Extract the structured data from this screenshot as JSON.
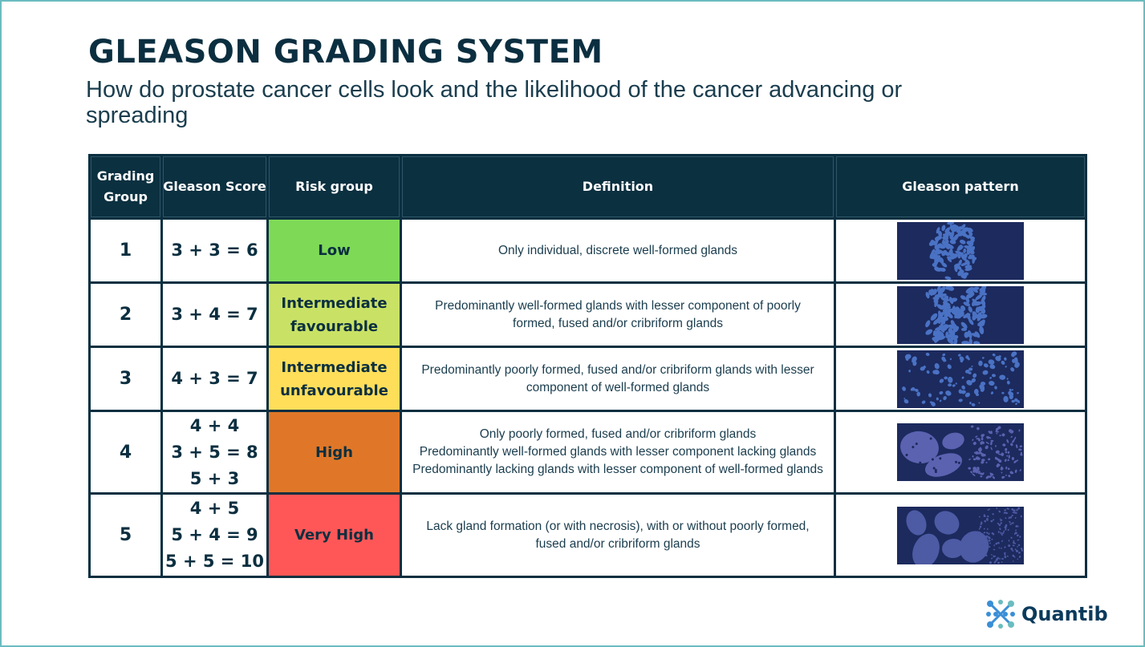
{
  "header": {
    "title": "GLEASON GRADING SYSTEM",
    "subtitle": "How do prostate cancer cells look and the likelihood of the cancer advancing or spreading"
  },
  "table": {
    "columns": [
      "Grading Group",
      "Gleason Score",
      "Risk group",
      "Definition",
      "Gleason pattern"
    ],
    "rows": [
      {
        "group": "1",
        "scores": [
          "3 + 3 = 6"
        ],
        "risk": "Low",
        "risk_color": "#7ed957",
        "definition": [
          "Only individual, discrete well-formed glands"
        ],
        "pattern_icon": "gleason-pattern-1-image"
      },
      {
        "group": "2",
        "scores": [
          "3 + 4 = 7"
        ],
        "risk": "Intermediate favourable",
        "risk_color": "#c9e265",
        "definition": [
          "Predominantly well-formed glands with lesser component of poorly formed, fused and/or cribriform glands"
        ],
        "pattern_icon": "gleason-pattern-2-image"
      },
      {
        "group": "3",
        "scores": [
          "4 + 3 = 7"
        ],
        "risk": "Intermediate unfavourable",
        "risk_color": "#ffde59",
        "definition": [
          "Predominantly poorly formed, fused and/or cribriform glands with lesser component of well-formed glands"
        ],
        "pattern_icon": "gleason-pattern-3-image"
      },
      {
        "group": "4",
        "scores": [
          "4 + 4",
          "3 + 5 = 8",
          "5 + 3"
        ],
        "risk": "High",
        "risk_color": "#e07728",
        "definition": [
          "Only poorly formed, fused and/or cribriform glands",
          "Predominantly well-formed glands with lesser component lacking glands",
          "Predominantly lacking glands with lesser component of well-formed glands"
        ],
        "pattern_icon": "gleason-pattern-4-image"
      },
      {
        "group": "5",
        "scores": [
          "4 + 5",
          "5 + 4 = 9",
          "5 + 5 = 10"
        ],
        "risk": "Very High",
        "risk_color": "#ff5757",
        "definition": [
          "Lack gland formation (or with necrosis), with or without poorly formed, fused and/or cribriform glands"
        ],
        "pattern_icon": "gleason-pattern-5-image"
      }
    ]
  },
  "logo": {
    "text": "Quantib",
    "icon": "quantib-logo-icon"
  },
  "colors": {
    "navy": "#0b2f40",
    "frame": "#6bbcbf",
    "pattern_bg": "#1c2a5e",
    "pattern_cells": "#4a72c4"
  }
}
